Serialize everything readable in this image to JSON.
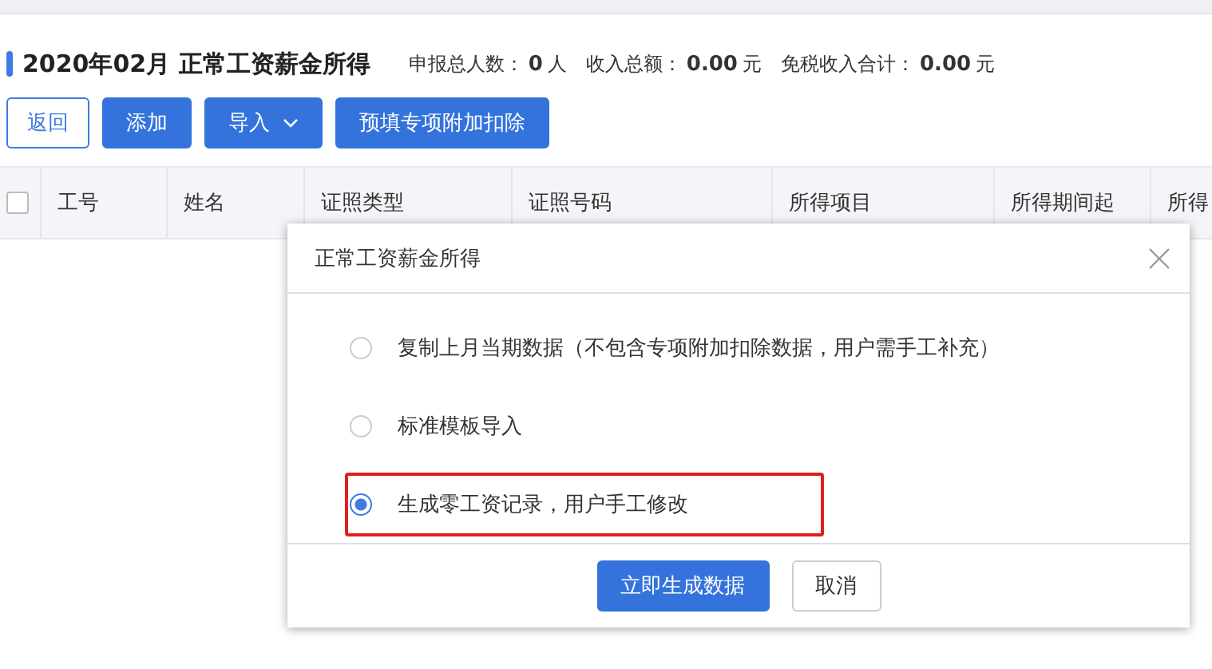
{
  "header": {
    "title": "2020年02月 正常工资薪金所得",
    "stats": [
      {
        "label": "申报总人数：",
        "value": "0",
        "unit": "人"
      },
      {
        "label": "收入总额：",
        "value": "0.00",
        "unit": "元"
      },
      {
        "label": "免税收入合计：",
        "value": "0.00",
        "unit": "元"
      }
    ]
  },
  "toolbar": [
    {
      "label": "返回",
      "kind": "outline"
    },
    {
      "label": "添加",
      "kind": "primary"
    },
    {
      "label": "导入",
      "kind": "dropdown"
    },
    {
      "label": "预填专项附加扣除",
      "kind": "primary"
    }
  ],
  "table": {
    "select_all_checked": false,
    "columns": [
      "工号",
      "姓名",
      "证照类型",
      "证照号码",
      "所得项目",
      "所得期间起",
      "所得"
    ]
  },
  "dialog": {
    "title": "正常工资薪金所得",
    "options": [
      {
        "label": "复制上月当期数据（不包含专项附加扣除数据，用户需手工补充）",
        "selected": false,
        "highlighted": false
      },
      {
        "label": "标准模板导入",
        "selected": false,
        "highlighted": false
      },
      {
        "label": "生成零工资记录，用户手工修改",
        "selected": true,
        "highlighted": true
      }
    ],
    "buttons": [
      {
        "label": "立即生成数据",
        "kind": "primary"
      },
      {
        "label": "取消",
        "kind": "default"
      }
    ]
  }
}
